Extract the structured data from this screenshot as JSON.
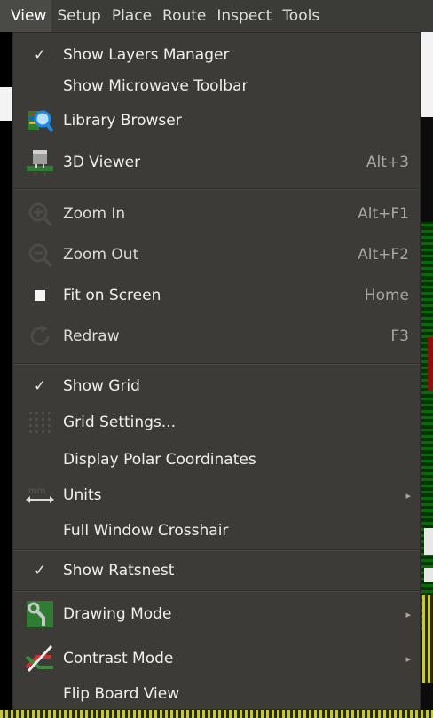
{
  "menubar": {
    "items": [
      "View",
      "Setup",
      "Place",
      "Route",
      "Inspect",
      "Tools"
    ]
  },
  "view_menu": {
    "items": [
      {
        "label": "Show Layers Manager",
        "checked": true
      },
      {
        "label": "Show Microwave Toolbar"
      },
      {
        "label": "Library Browser",
        "icon": "library-browser-icon"
      },
      {
        "label": "3D Viewer",
        "accel": "Alt+3",
        "icon": "3d-viewer-icon"
      },
      {
        "label": "Zoom In",
        "accel": "Alt+F1",
        "icon": "zoom-in-icon"
      },
      {
        "label": "Zoom Out",
        "accel": "Alt+F2",
        "icon": "zoom-out-icon"
      },
      {
        "label": "Fit on Screen",
        "accel": "Home",
        "icon": "fit-screen-icon"
      },
      {
        "label": "Redraw",
        "accel": "F3",
        "icon": "redraw-icon"
      },
      {
        "label": "Show Grid",
        "checked": true
      },
      {
        "label": "Grid Settings...",
        "icon": "grid-icon"
      },
      {
        "label": "Display Polar Coordinates"
      },
      {
        "label": "Units",
        "submenu": true,
        "icon": "units-icon"
      },
      {
        "label": "Full Window Crosshair"
      },
      {
        "label": "Show Ratsnest",
        "checked": true
      },
      {
        "label": "Drawing Mode",
        "submenu": true,
        "icon": "drawing-mode-icon"
      },
      {
        "label": "Contrast Mode",
        "submenu": true,
        "icon": "contrast-mode-icon"
      },
      {
        "label": "Flip Board View"
      }
    ]
  },
  "glyphs": {
    "check": "✓",
    "submenu_arrow": "▸"
  }
}
